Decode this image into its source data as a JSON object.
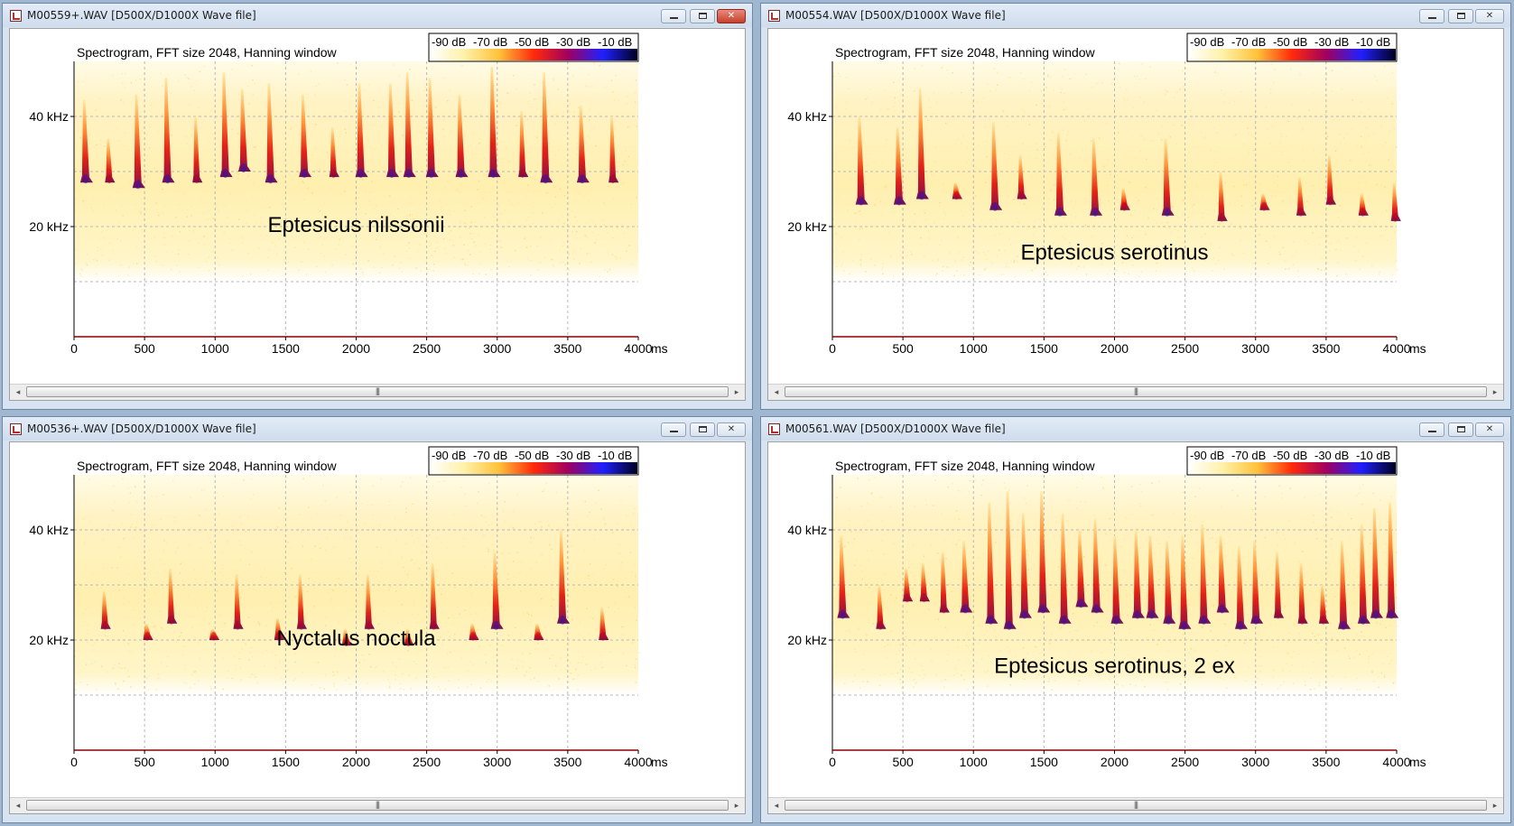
{
  "windows": [
    {
      "title": "M00559+.WAV [D500X/D1000X Wave file]",
      "close_active": true,
      "chart_title": "Spectrogram, FFT size 2048, Hanning window",
      "species": "Eptesicus nilssonii",
      "calls": [
        {
          "t": 70,
          "top": 43,
          "bot": 28
        },
        {
          "t": 240,
          "top": 36,
          "bot": 28
        },
        {
          "t": 440,
          "top": 44,
          "bot": 27
        },
        {
          "t": 650,
          "top": 47,
          "bot": 28
        },
        {
          "t": 860,
          "top": 40,
          "bot": 28
        },
        {
          "t": 1060,
          "top": 48,
          "bot": 29
        },
        {
          "t": 1190,
          "top": 45,
          "bot": 30
        },
        {
          "t": 1380,
          "top": 46,
          "bot": 28
        },
        {
          "t": 1620,
          "top": 44,
          "bot": 29
        },
        {
          "t": 1830,
          "top": 38,
          "bot": 29
        },
        {
          "t": 2020,
          "top": 46,
          "bot": 29
        },
        {
          "t": 2240,
          "top": 46,
          "bot": 29
        },
        {
          "t": 2360,
          "top": 48,
          "bot": 29
        },
        {
          "t": 2520,
          "top": 47,
          "bot": 29
        },
        {
          "t": 2730,
          "top": 44,
          "bot": 29
        },
        {
          "t": 2960,
          "top": 49,
          "bot": 29
        },
        {
          "t": 3170,
          "top": 41,
          "bot": 29
        },
        {
          "t": 3330,
          "top": 48,
          "bot": 28
        },
        {
          "t": 3590,
          "top": 42,
          "bot": 28
        },
        {
          "t": 3810,
          "top": 40,
          "bot": 28
        }
      ]
    },
    {
      "title": "M00554.WAV [D500X/D1000X Wave file]",
      "close_active": false,
      "chart_title": "Spectrogram, FFT size 2048, Hanning window",
      "species": "Eptesicus serotinus",
      "calls": [
        {
          "t": 190,
          "top": 40,
          "bot": 24
        },
        {
          "t": 460,
          "top": 38,
          "bot": 24
        },
        {
          "t": 620,
          "top": 45,
          "bot": 25
        },
        {
          "t": 870,
          "top": 28,
          "bot": 25
        },
        {
          "t": 1140,
          "top": 39,
          "bot": 23
        },
        {
          "t": 1330,
          "top": 33,
          "bot": 25
        },
        {
          "t": 1600,
          "top": 37,
          "bot": 22
        },
        {
          "t": 1850,
          "top": 36,
          "bot": 22
        },
        {
          "t": 2060,
          "top": 27,
          "bot": 23
        },
        {
          "t": 2360,
          "top": 36,
          "bot": 22
        },
        {
          "t": 2750,
          "top": 30,
          "bot": 21
        },
        {
          "t": 3050,
          "top": 26,
          "bot": 23
        },
        {
          "t": 3310,
          "top": 29,
          "bot": 22
        },
        {
          "t": 3520,
          "top": 33,
          "bot": 24
        },
        {
          "t": 3750,
          "top": 26,
          "bot": 22
        },
        {
          "t": 3980,
          "top": 28,
          "bot": 21
        }
      ]
    },
    {
      "title": "M00536+.WAV [D500X/D1000X Wave file]",
      "close_active": false,
      "chart_title": "Spectrogram, FFT size 2048, Hanning window",
      "species": "Nyctalus noctula",
      "calls": [
        {
          "t": 210,
          "top": 29,
          "bot": 22
        },
        {
          "t": 510,
          "top": 23,
          "bot": 20
        },
        {
          "t": 680,
          "top": 33,
          "bot": 23
        },
        {
          "t": 980,
          "top": 22,
          "bot": 20
        },
        {
          "t": 1150,
          "top": 32,
          "bot": 22
        },
        {
          "t": 1440,
          "top": 24,
          "bot": 20
        },
        {
          "t": 1600,
          "top": 32,
          "bot": 22
        },
        {
          "t": 1920,
          "top": 22,
          "bot": 19
        },
        {
          "t": 2080,
          "top": 32,
          "bot": 22
        },
        {
          "t": 2360,
          "top": 22,
          "bot": 19
        },
        {
          "t": 2540,
          "top": 34,
          "bot": 22
        },
        {
          "t": 2820,
          "top": 23,
          "bot": 20
        },
        {
          "t": 2980,
          "top": 36,
          "bot": 22
        },
        {
          "t": 3280,
          "top": 23,
          "bot": 20
        },
        {
          "t": 3450,
          "top": 40,
          "bot": 23
        },
        {
          "t": 3740,
          "top": 26,
          "bot": 20
        }
      ]
    },
    {
      "title": "M00561.WAV [D500X/D1000X Wave file]",
      "close_active": false,
      "chart_title": "Spectrogram, FFT size 2048, Hanning window",
      "species": "Eptesicus serotinus, 2 ex",
      "calls": [
        {
          "t": 60,
          "top": 39,
          "bot": 24
        },
        {
          "t": 330,
          "top": 30,
          "bot": 22
        },
        {
          "t": 520,
          "top": 33,
          "bot": 27
        },
        {
          "t": 640,
          "top": 34,
          "bot": 27
        },
        {
          "t": 780,
          "top": 36,
          "bot": 25
        },
        {
          "t": 930,
          "top": 38,
          "bot": 25
        },
        {
          "t": 1110,
          "top": 45,
          "bot": 23
        },
        {
          "t": 1240,
          "top": 47,
          "bot": 22
        },
        {
          "t": 1350,
          "top": 43,
          "bot": 24
        },
        {
          "t": 1480,
          "top": 47,
          "bot": 25
        },
        {
          "t": 1630,
          "top": 43,
          "bot": 23
        },
        {
          "t": 1750,
          "top": 40,
          "bot": 26
        },
        {
          "t": 1860,
          "top": 42,
          "bot": 25
        },
        {
          "t": 2000,
          "top": 39,
          "bot": 23
        },
        {
          "t": 2150,
          "top": 40,
          "bot": 24
        },
        {
          "t": 2250,
          "top": 39,
          "bot": 24
        },
        {
          "t": 2370,
          "top": 38,
          "bot": 23
        },
        {
          "t": 2480,
          "top": 39,
          "bot": 22
        },
        {
          "t": 2620,
          "top": 41,
          "bot": 23
        },
        {
          "t": 2750,
          "top": 39,
          "bot": 25
        },
        {
          "t": 2880,
          "top": 37,
          "bot": 22
        },
        {
          "t": 2990,
          "top": 38,
          "bot": 23
        },
        {
          "t": 3150,
          "top": 36,
          "bot": 24
        },
        {
          "t": 3320,
          "top": 34,
          "bot": 23
        },
        {
          "t": 3470,
          "top": 30,
          "bot": 23
        },
        {
          "t": 3610,
          "top": 38,
          "bot": 22
        },
        {
          "t": 3750,
          "top": 41,
          "bot": 23
        },
        {
          "t": 3840,
          "top": 44,
          "bot": 24
        },
        {
          "t": 3950,
          "top": 45,
          "bot": 24
        }
      ]
    }
  ],
  "scale": {
    "labels": [
      "-90 dB",
      "-70 dB",
      "-50 dB",
      "-30 dB",
      "-10 dB"
    ],
    "colors": [
      "#ffffff",
      "#fff1a8",
      "#ffc23a",
      "#ff2a0a",
      "#a00060",
      "#2020ff",
      "#000020"
    ]
  },
  "axes": {
    "x_ticks": [
      "0",
      "500",
      "1000",
      "1500",
      "2000",
      "2500",
      "3000",
      "3500",
      "4000"
    ],
    "x_unit": "ms",
    "y_labels": [
      "40 kHz",
      "20 kHz"
    ]
  },
  "chart_data": [
    {
      "type": "heatmap",
      "title": "Spectrogram, FFT size 2048, Hanning window",
      "annotation": "Eptesicus nilssonii",
      "xlim": [
        0,
        4000
      ],
      "ylim": [
        0,
        50
      ],
      "xlabel": "ms"
    },
    {
      "type": "heatmap",
      "title": "Spectrogram, FFT size 2048, Hanning window",
      "annotation": "Eptesicus serotinus",
      "xlim": [
        0,
        4000
      ],
      "ylim": [
        0,
        50
      ],
      "xlabel": "ms"
    },
    {
      "type": "heatmap",
      "title": "Spectrogram, FFT size 2048, Hanning window",
      "annotation": "Nyctalus noctula",
      "xlim": [
        0,
        4000
      ],
      "ylim": [
        0,
        50
      ],
      "xlabel": "ms"
    },
    {
      "type": "heatmap",
      "title": "Spectrogram, FFT size 2048, Hanning window",
      "annotation": "Eptesicus serotinus, 2 ex",
      "xlim": [
        0,
        4000
      ],
      "ylim": [
        0,
        50
      ],
      "xlabel": "ms"
    }
  ]
}
